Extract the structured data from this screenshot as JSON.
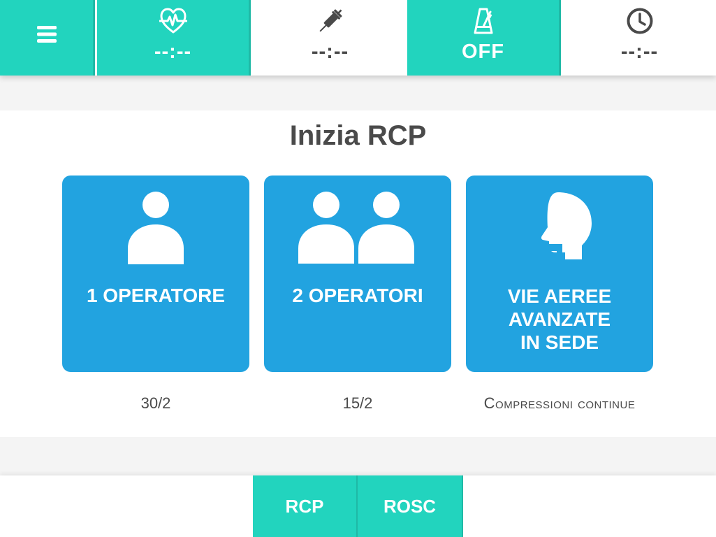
{
  "topbar": {
    "menu_icon": "hamburger-menu-icon",
    "heart_timer": {
      "icon": "heart-pulse-icon",
      "value": "--:--"
    },
    "syringe_timer": {
      "icon": "syringe-icon",
      "value": "--:--"
    },
    "metronome": {
      "icon": "metronome-icon",
      "value": "OFF"
    },
    "clock_timer": {
      "icon": "clock-icon",
      "value": "--:--"
    }
  },
  "main": {
    "title": "Inizia RCP",
    "cards": [
      {
        "icon": "single-person-icon",
        "label": "1 OPERATORE",
        "ratio": "30/2"
      },
      {
        "icon": "two-persons-icon",
        "label": "2 OPERATORI",
        "ratio": "15/2"
      },
      {
        "icon": "airway-head-icon",
        "label_lines": [
          "VIE AEREE",
          "AVANZATE",
          "IN SEDE"
        ],
        "ratio": "Compressioni continue"
      }
    ]
  },
  "bottombar": {
    "tabs": [
      {
        "label": "RCP"
      },
      {
        "label": "ROSC"
      }
    ]
  },
  "colors": {
    "teal": "#22d4be",
    "blue": "#22a3e0",
    "text": "#4a4a4a",
    "background": "#f4f4f4"
  }
}
